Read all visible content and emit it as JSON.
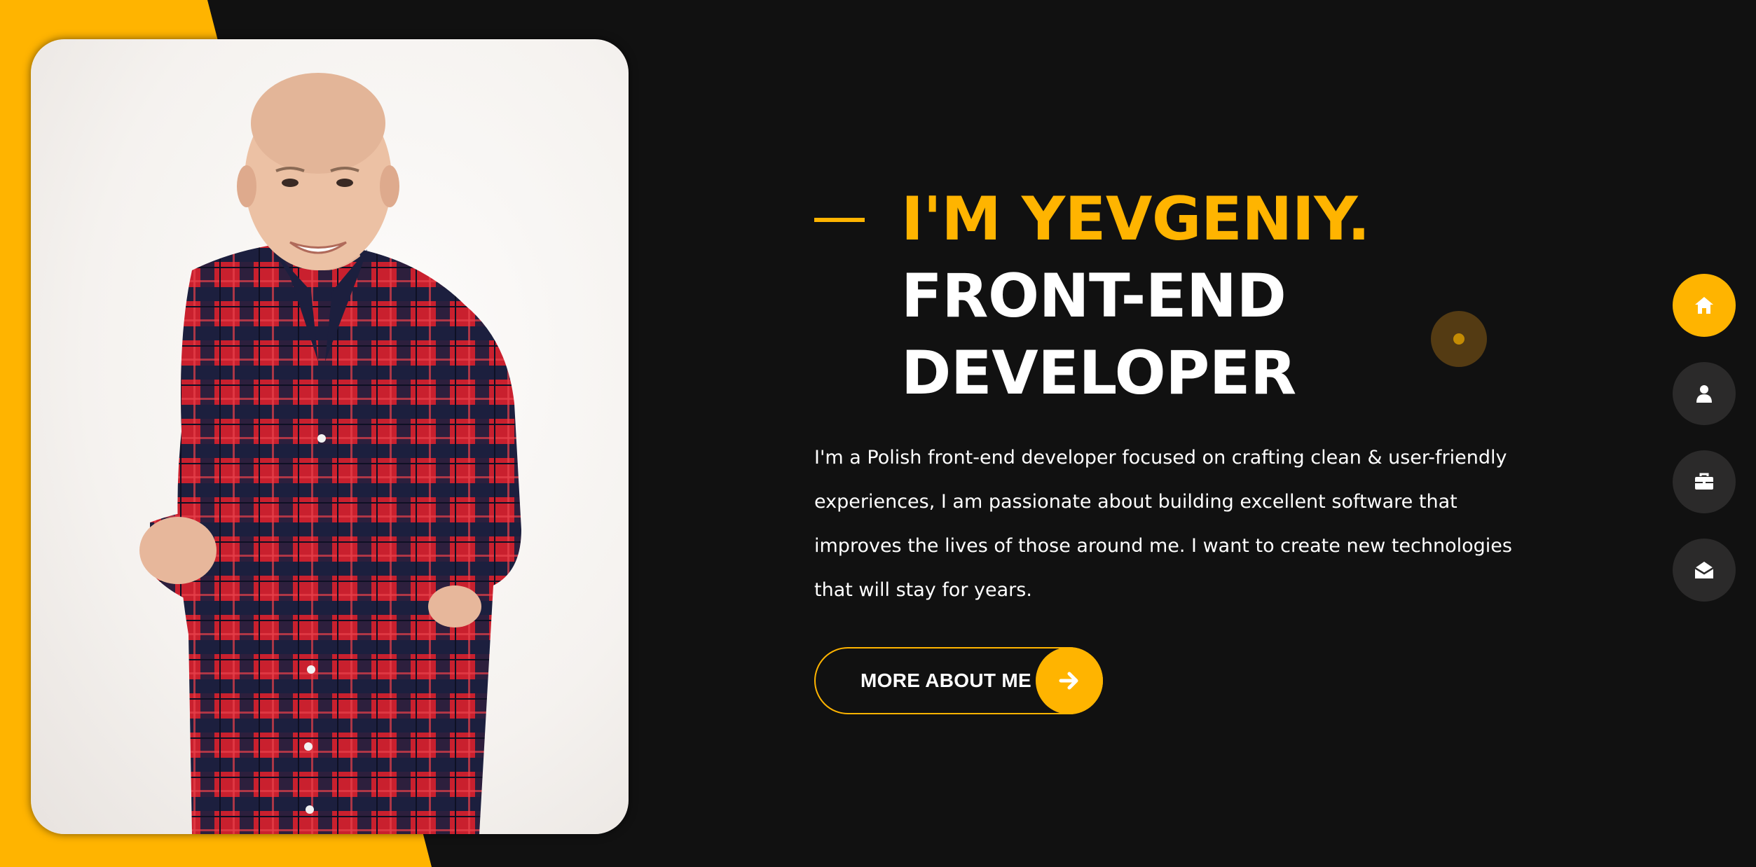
{
  "hero": {
    "title_line1": "I'M YEVGENIY.",
    "title_line2": "FRONT-END",
    "title_line3": "DEVELOPER",
    "description": "I'm a Polish front-end developer focused on crafting clean & user-friendly experiences, I am passionate about building excellent software that improves the lives of those around me. I want to create new technologies that will stay for years."
  },
  "cta": {
    "label": "MORE ABOUT ME",
    "icon": "arrow-right-icon"
  },
  "nav": {
    "items": [
      {
        "name": "home",
        "icon": "home-icon",
        "active": true
      },
      {
        "name": "about",
        "icon": "user-icon",
        "active": false
      },
      {
        "name": "portfolio",
        "icon": "briefcase-icon",
        "active": false
      },
      {
        "name": "contact",
        "icon": "envelope-open-icon",
        "active": false
      }
    ]
  },
  "colors": {
    "accent": "#ffb400",
    "background": "#111111",
    "nav_inactive": "#2b2a2a",
    "text": "#ffffff"
  }
}
